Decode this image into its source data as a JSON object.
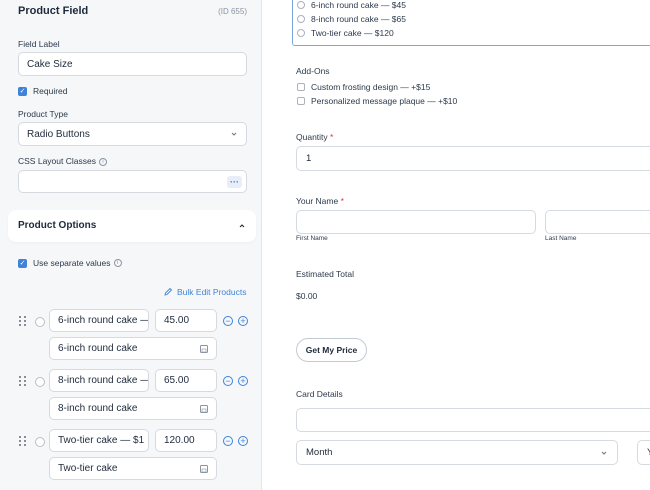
{
  "sidebar": {
    "title": "Product Field",
    "id_label": "(ID 655)",
    "field_label": {
      "label": "Field Label",
      "value": "Cake Size"
    },
    "required": {
      "label": "Required",
      "checked": true
    },
    "product_type": {
      "label": "Product Type",
      "value": "Radio Buttons"
    },
    "css_classes": {
      "label": "CSS Layout Classes",
      "value": "",
      "button": "···"
    },
    "product_options": {
      "title": "Product Options",
      "separate_values": {
        "label": "Use separate values",
        "checked": true
      },
      "bulk_edit": "Bulk Edit Products",
      "items": [
        {
          "label": "6-inch round cake —",
          "price": "45.00",
          "value": "6-inch round cake"
        },
        {
          "label": "8-inch round cake —",
          "price": "65.00",
          "value": "8-inch round cake"
        },
        {
          "label": "Two-tier cake — $1",
          "price": "120.00",
          "value": "Two-tier cake"
        }
      ]
    }
  },
  "form": {
    "cake_options": [
      "6-inch round cake — $45",
      "8-inch round cake — $65",
      "Two-tier cake — $120"
    ],
    "addons": {
      "label": "Add-Ons",
      "items": [
        "Custom frosting design — +$15",
        "Personalized message plaque — +$10"
      ]
    },
    "quantity": {
      "label": "Quantity",
      "required_mark": "*",
      "value": "1"
    },
    "name": {
      "label": "Your Name",
      "required_mark": "*",
      "first_label": "First Name",
      "last_label": "Last Name"
    },
    "estimated_total": {
      "label": "Estimated Total",
      "value": "$0.00"
    },
    "price_button": "Get My Price",
    "card": {
      "label": "Card Details",
      "month": "Month",
      "year": "Y"
    }
  },
  "colors": {
    "accent": "#3f83d8",
    "required": "#d6393f",
    "sidebar_bg": "#f6f7f9"
  }
}
